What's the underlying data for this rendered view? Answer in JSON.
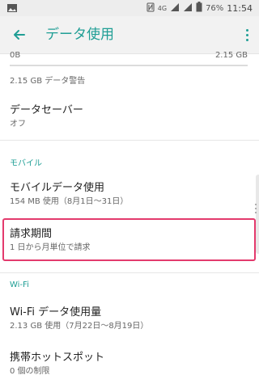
{
  "status_bar": {
    "left_icon": "image-icon",
    "icons": [
      "nfc-icon",
      "4g-icon",
      "signal-icon",
      "signal-icon-2",
      "battery-icon"
    ],
    "network_type": "4G",
    "battery_percent": "76%",
    "time": "11:54"
  },
  "app_bar": {
    "back_icon": "arrow-back-icon",
    "title": "データ使用",
    "menu_icon": "more-vert-icon"
  },
  "usage": {
    "left_value": "0B",
    "right_value": "2.15 GB",
    "warning_text": "2.15 GB データ警告"
  },
  "items": [
    {
      "title": "データセーバー",
      "subtitle": "オフ"
    },
    {
      "section": "モバイル"
    },
    {
      "title": "モバイルデータ使用",
      "subtitle": "154 MB 使用（8月1日〜31日）"
    },
    {
      "title": "請求期間",
      "subtitle": "1 日から月単位で請求"
    },
    {
      "section": "Wi-Fi"
    },
    {
      "title": "Wi-Fi データ使用量",
      "subtitle": "2.13 GB 使用（7月22日〜8月19日）"
    },
    {
      "title": "携帯ホットスポット",
      "subtitle": "0 個の制限"
    }
  ],
  "colors": {
    "accent": "#1f9e95",
    "highlight": "#e33a6d",
    "text_primary": "#222222",
    "text_secondary": "#666666"
  }
}
